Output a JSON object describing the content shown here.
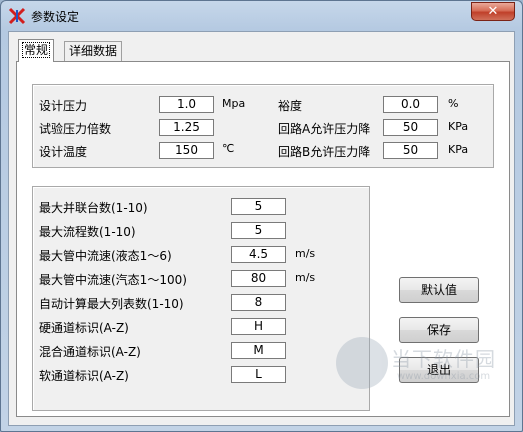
{
  "window": {
    "title": "参数设定",
    "close_label": "✕"
  },
  "tabs": [
    {
      "label": "常规",
      "active": true
    },
    {
      "label": "详细数据",
      "active": false
    }
  ],
  "design": {
    "pressure": {
      "label": "设计压力",
      "value": "1.0",
      "unit": "Mpa"
    },
    "test_factor": {
      "label": "试验压力倍数",
      "value": "1.25"
    },
    "temperature": {
      "label": "设计温度",
      "value": "150",
      "unit": "℃"
    },
    "margin": {
      "label": "裕度",
      "value": "0.0",
      "unit": "%"
    },
    "loop_a": {
      "label": "回路A允许压力降",
      "value": "50",
      "unit": "KPa"
    },
    "loop_b": {
      "label": "回路B允许压力降",
      "value": "50",
      "unit": "KPa"
    }
  },
  "limits": [
    {
      "label": "最大并联台数(1-10)",
      "value": "5",
      "unit": ""
    },
    {
      "label": "最大流程数(1-10)",
      "value": "5",
      "unit": ""
    },
    {
      "label": "最大管中流速(液态1～6)",
      "value": "4.5",
      "unit": "m/s"
    },
    {
      "label": "最大管中流速(汽态1～100)",
      "value": "80",
      "unit": "m/s"
    },
    {
      "label": "自动计算最大列表数(1-10)",
      "value": "8",
      "unit": ""
    },
    {
      "label": "硬通道标识(A-Z)",
      "value": "H",
      "unit": ""
    },
    {
      "label": "混合通道标识(A-Z)",
      "value": "M",
      "unit": ""
    },
    {
      "label": "软通道标识(A-Z)",
      "value": "L",
      "unit": ""
    }
  ],
  "buttons": {
    "default": "默认值",
    "save": "保存",
    "exit": "退出"
  },
  "watermark": {
    "text": "当下软件园",
    "url": "www.downxia.com"
  },
  "colors": {
    "titlebar": "#b4c9e1",
    "close": "#c0402a",
    "panel": "#f0f0f0"
  }
}
